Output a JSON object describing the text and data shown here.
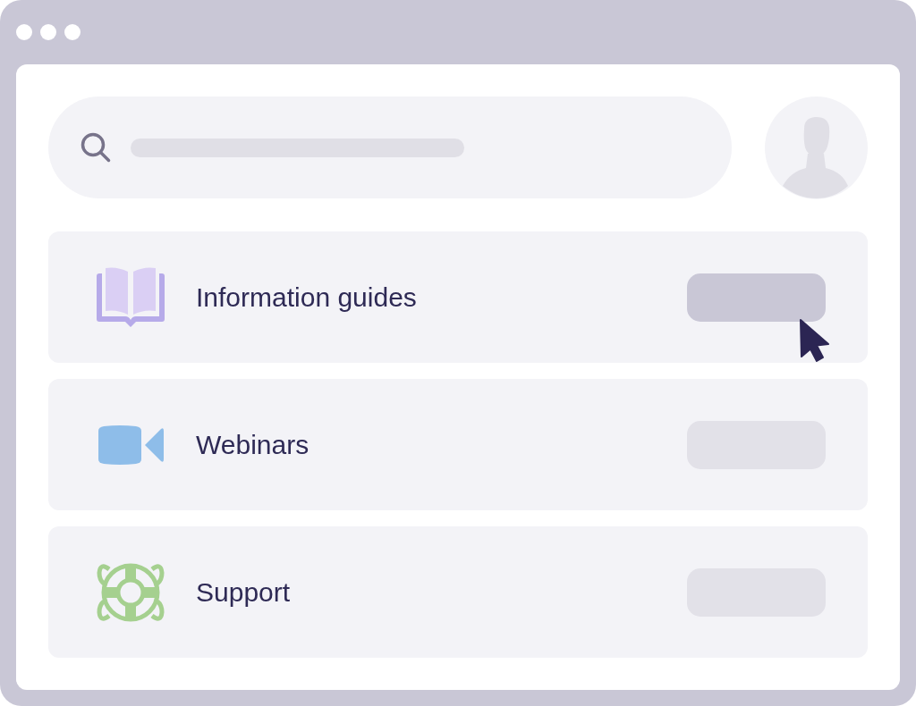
{
  "items": [
    {
      "label": "Information guides",
      "selected": true
    },
    {
      "label": "Webinars",
      "selected": false
    },
    {
      "label": "Support",
      "selected": false
    }
  ]
}
